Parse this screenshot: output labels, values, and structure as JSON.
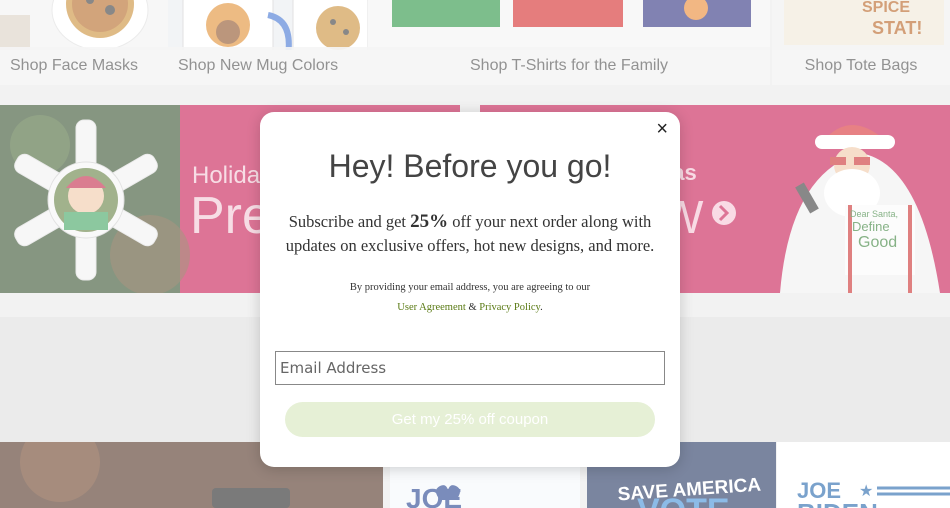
{
  "categories": [
    {
      "label": "Shop Face Masks"
    },
    {
      "label": "Shop New Mug Colors"
    },
    {
      "label": "Shop T-Shirts for the Family"
    },
    {
      "label": "Shop Tote Bags"
    }
  ],
  "banners": {
    "left_text_1": "Holiday",
    "left_text_2": "Pre",
    "right_text_1": "eas",
    "right_text_2": "W",
    "tote_text_1": "SPICE",
    "tote_text_2": "STAT!",
    "santa_shirt_1": "Dear Santa,",
    "santa_shirt_2": "Define",
    "santa_shirt_3": "Good"
  },
  "lower_tiles": {
    "heart_text": "JOE",
    "save_america": "SAVE AMERICA",
    "vote": "VOTE",
    "joe": "JOE",
    "biden": "BIDEN"
  },
  "modal": {
    "close_label": "×",
    "title": "Hey! Before you go!",
    "text_part1": "Subscribe and get ",
    "discount": "25%",
    "text_part2": " off your next order along with updates on exclusive offers, hot new designs, and more.",
    "legal_line1": "By providing your email address, you are agreeing to our",
    "user_agreement": "User Agreement",
    "amp": " & ",
    "privacy_policy": "Privacy Policy",
    "period": ".",
    "email_placeholder": "Email Address",
    "submit_label": "Get my 25% off coupon"
  },
  "colors": {
    "banner_bg": "#c4104a",
    "link": "#5a7a14",
    "submit_bg": "#e6f0d6"
  }
}
